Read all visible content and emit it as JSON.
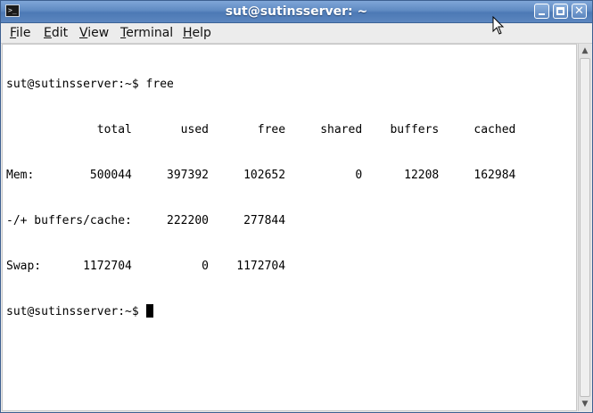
{
  "window": {
    "title": "sut@sutinsserver: ~",
    "app_icon_glyph": ">_",
    "buttons": {
      "minimize": "minimize-icon",
      "maximize": "maximize-icon",
      "close": "close-icon"
    }
  },
  "menubar": {
    "items": [
      {
        "mnemonic": "F",
        "rest": "ile"
      },
      {
        "mnemonic": "E",
        "rest": "dit"
      },
      {
        "mnemonic": "V",
        "rest": "iew"
      },
      {
        "mnemonic": "T",
        "rest": "erminal"
      },
      {
        "mnemonic": "H",
        "rest": "elp"
      }
    ]
  },
  "terminal": {
    "prompt": "sut@sutinsserver:~$ ",
    "command": "free",
    "header": "             total       used       free     shared    buffers     cached",
    "rows": [
      "Mem:        500044     397392     102652          0      12208     162984",
      "-/+ buffers/cache:     222200     277844",
      "Swap:      1172704          0    1172704"
    ],
    "final_prompt": "sut@sutinsserver:~$ "
  },
  "colors": {
    "titlebar": "#5f8ac2",
    "terminal_bg": "#ffffff",
    "terminal_fg": "#000000"
  }
}
